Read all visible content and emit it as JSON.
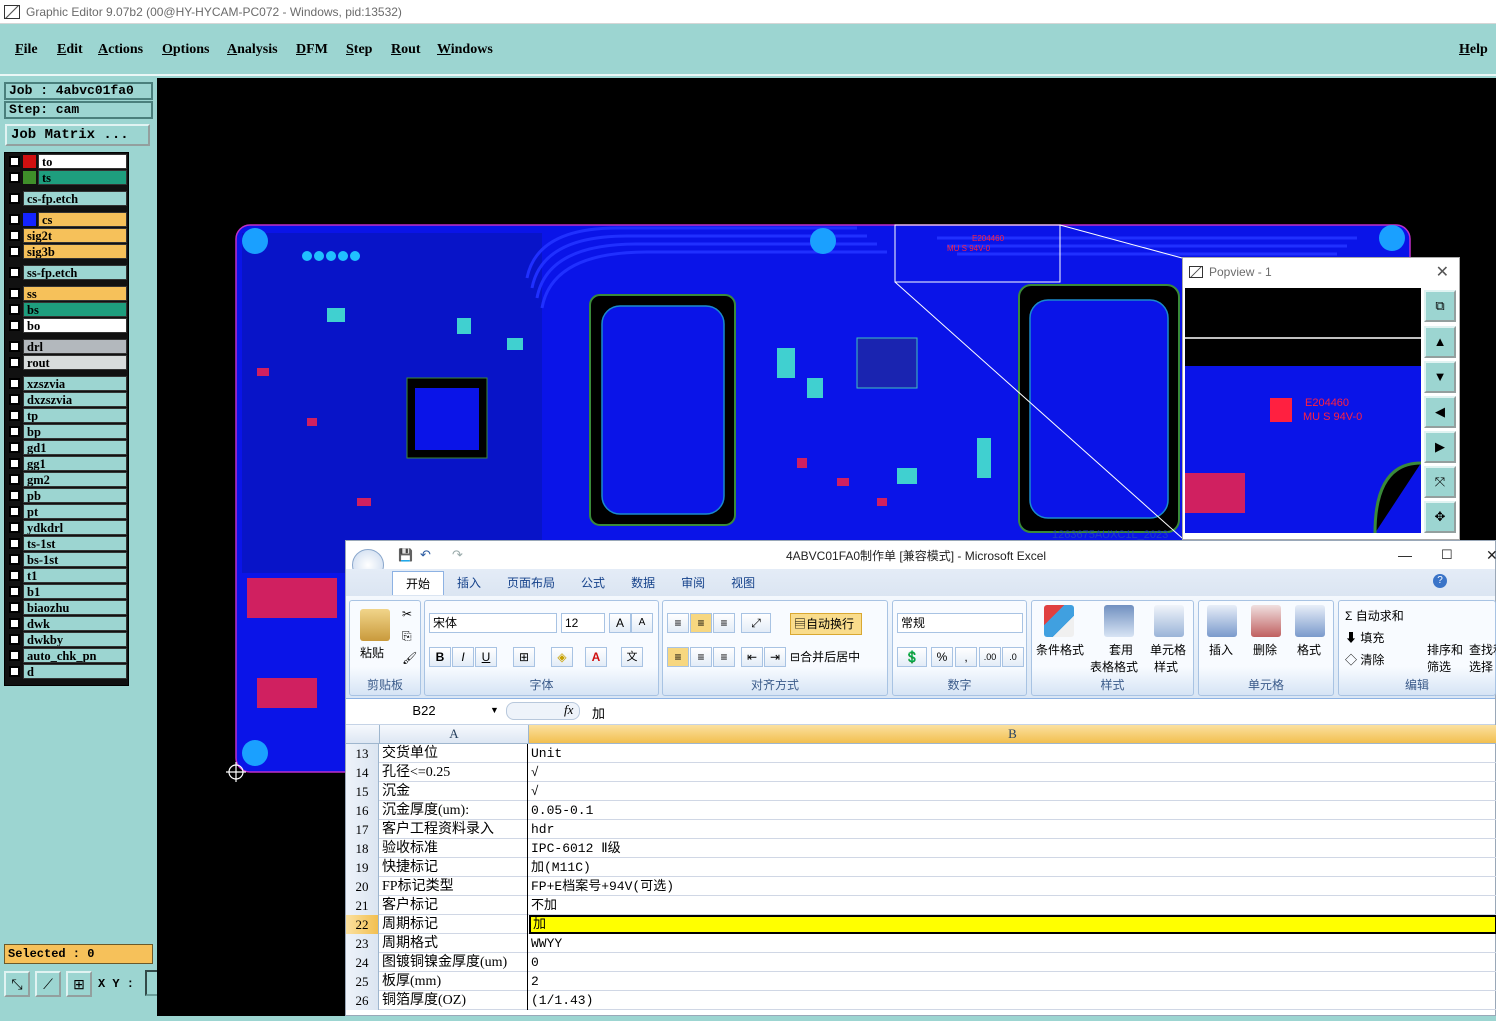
{
  "window": {
    "title": "Graphic Editor 9.07b2 (00@HY-HYCAM-PC072 - Windows, pid:13532)"
  },
  "menu": {
    "items": [
      "File",
      "Edit",
      "Actions",
      "Options",
      "Analysis",
      "DFM",
      "Step",
      "Rout",
      "Windows"
    ],
    "help": "Help"
  },
  "job": {
    "job_label": "Job : 4abvc01fa0",
    "step_label": "Step: cam",
    "matrix_button": "Job Matrix ..."
  },
  "layers": [
    {
      "name": "to",
      "color": "#ffffff",
      "swatch": "#d01010"
    },
    {
      "name": "ts",
      "color": "#1e9e7e",
      "swatch": "#3f8f2a"
    },
    {
      "name": "cs-fp.etch",
      "color": "#9cd5d1",
      "swatch": ""
    },
    {
      "name": "cs",
      "color": "#f6c15a",
      "swatch": "#1424ff"
    },
    {
      "name": "sig2t",
      "color": "#f6c15a",
      "swatch": ""
    },
    {
      "name": "sig3b",
      "color": "#f6c15a",
      "swatch": ""
    },
    {
      "name": "ss-fp.etch",
      "color": "#9cd5d1",
      "swatch": ""
    },
    {
      "name": "ss",
      "color": "#f6c15a",
      "swatch": ""
    },
    {
      "name": "bs",
      "color": "#1e9e7e",
      "swatch": ""
    },
    {
      "name": "bo",
      "color": "#ffffff",
      "swatch": ""
    },
    {
      "name": "drl",
      "color": "#b3b8bd",
      "swatch": ""
    },
    {
      "name": "rout",
      "color": "#d8dcdc",
      "swatch": ""
    },
    {
      "name": "xzszvia",
      "color": "#9cd5d1",
      "swatch": ""
    },
    {
      "name": "dxzszvia",
      "color": "#9cd5d1",
      "swatch": ""
    },
    {
      "name": "tp",
      "color": "#9cd5d1",
      "swatch": ""
    },
    {
      "name": "bp",
      "color": "#9cd5d1",
      "swatch": ""
    },
    {
      "name": "gd1",
      "color": "#9cd5d1",
      "swatch": ""
    },
    {
      "name": "gg1",
      "color": "#9cd5d1",
      "swatch": ""
    },
    {
      "name": "gm2",
      "color": "#9cd5d1",
      "swatch": ""
    },
    {
      "name": "pb",
      "color": "#9cd5d1",
      "swatch": ""
    },
    {
      "name": "pt",
      "color": "#9cd5d1",
      "swatch": ""
    },
    {
      "name": "ydkdrl",
      "color": "#9cd5d1",
      "swatch": ""
    },
    {
      "name": "ts-1st",
      "color": "#9cd5d1",
      "swatch": ""
    },
    {
      "name": "bs-1st",
      "color": "#9cd5d1",
      "swatch": ""
    },
    {
      "name": "t1",
      "color": "#9cd5d1",
      "swatch": ""
    },
    {
      "name": "b1",
      "color": "#9cd5d1",
      "swatch": ""
    },
    {
      "name": "biaozhu",
      "color": "#9cd5d1",
      "swatch": ""
    },
    {
      "name": "dwk",
      "color": "#9cd5d1",
      "swatch": ""
    },
    {
      "name": "dwkby",
      "color": "#9cd5d1",
      "swatch": ""
    },
    {
      "name": "auto_chk_pn",
      "color": "#9cd5d1",
      "swatch": ""
    },
    {
      "name": "d",
      "color": "#9cd5d1",
      "swatch": ""
    }
  ],
  "status": {
    "selected": "Selected : 0",
    "xy_label": "X Y :"
  },
  "pcb": {
    "marking": "E204460",
    "ul": "MU S 94V-0",
    "bottom_text": "1263675AUXC1L_2023"
  },
  "popview": {
    "title": "Popview - 1"
  },
  "excel": {
    "title": "4ABVC01FA0制作单  [兼容模式] - Microsoft Excel",
    "tabs": [
      "开始",
      "插入",
      "页面布局",
      "公式",
      "数据",
      "审阅",
      "视图"
    ],
    "ribbon": {
      "paste": "粘贴",
      "clipboard": "剪贴板",
      "font_name": "宋体",
      "font_size": "12",
      "font_group": "字体",
      "wrap": "自动换行",
      "merge": "合并后居中",
      "align_group": "对齐方式",
      "number_format": "常规",
      "number_group": "数字",
      "cond_format": "条件格式",
      "table_format_1": "套用",
      "table_format_2": "表格格式",
      "cell_style_1": "单元格",
      "cell_style_2": "样式",
      "style_group": "样式",
      "insert": "插入",
      "delete": "删除",
      "format": "格式",
      "cells_group": "单元格",
      "autosum": "自动求和",
      "fill": "填充",
      "clear": "清除",
      "sort_1": "排序和",
      "sort_2": "筛选",
      "find_1": "查找和",
      "find_2": "选择",
      "edit_group": "编辑"
    },
    "name_box": "B22",
    "fx": "fx",
    "formula": "加",
    "col_a": "A",
    "col_b": "B",
    "rows": [
      {
        "n": "13",
        "a": "交货单位",
        "b": "Unit"
      },
      {
        "n": "14",
        "a": "孔径<=0.25",
        "b": "√"
      },
      {
        "n": "15",
        "a": "沉金",
        "b": "√"
      },
      {
        "n": "16",
        "a": "沉金厚度(um):",
        "b": "0.05-0.1"
      },
      {
        "n": "17",
        "a": "客户工程资料录入",
        "b": "hdr"
      },
      {
        "n": "18",
        "a": "验收标准",
        "b": "IPC-6012 Ⅱ级"
      },
      {
        "n": "19",
        "a": "快捷标记",
        "b": "加(M11C)"
      },
      {
        "n": "20",
        "a": "FP标记类型",
        "b": "FP+E档案号+94V(可选)"
      },
      {
        "n": "21",
        "a": "客户标记",
        "b": "不加"
      },
      {
        "n": "22",
        "a": "周期标记",
        "b": "加"
      },
      {
        "n": "23",
        "a": "周期格式",
        "b": "WWYY"
      },
      {
        "n": "24",
        "a": "图镀铜镍金厚度(um)",
        "b": "0"
      },
      {
        "n": "25",
        "a": "板厚(mm)",
        "b": "2"
      },
      {
        "n": "26",
        "a": "铜箔厚度(OZ)",
        "b": "(1/1.43)"
      }
    ]
  }
}
